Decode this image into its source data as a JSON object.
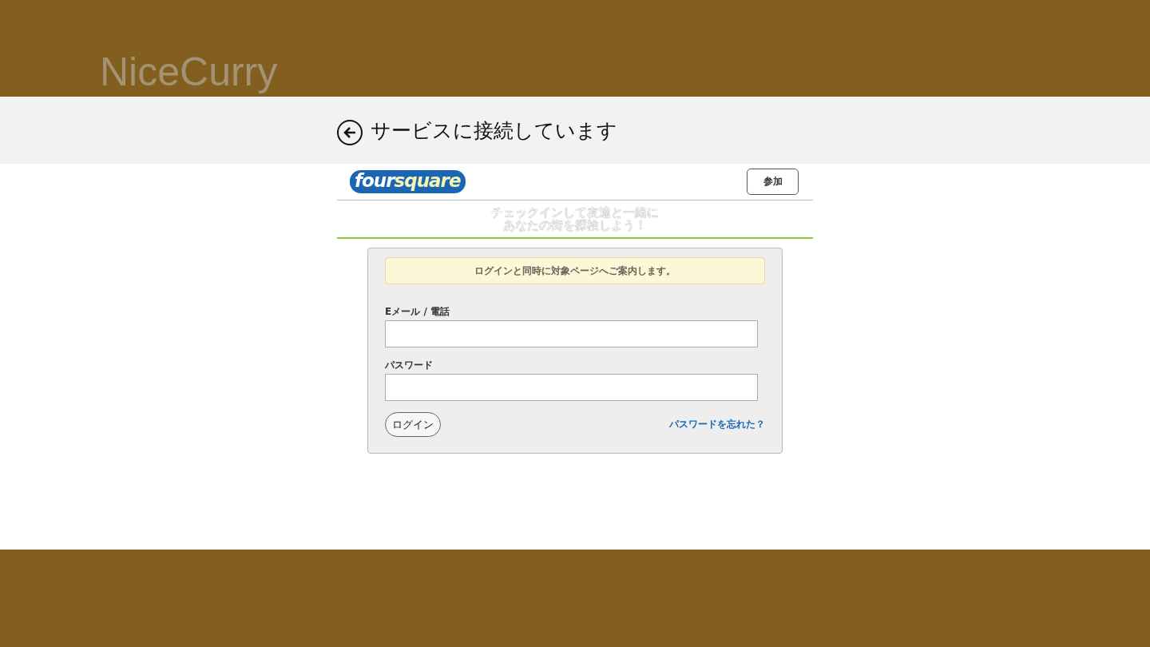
{
  "app": {
    "title": "NiceCurry"
  },
  "header": {
    "title": "サービスに接続しています"
  },
  "site": {
    "logo": {
      "part_1": "four",
      "part_2": "square"
    },
    "join_button": "参加",
    "tagline": [
      "チェックインして友達と一緒に",
      "あなたの街を探検しよう！"
    ]
  },
  "login": {
    "notice": "ログインと同時に対象ページへご案内します。",
    "fields": [
      {
        "label": "Eメール / 電話"
      },
      {
        "label": "パスワード"
      }
    ],
    "submit": "ログイン",
    "forgot_link": "パスワードを忘れた？"
  }
}
